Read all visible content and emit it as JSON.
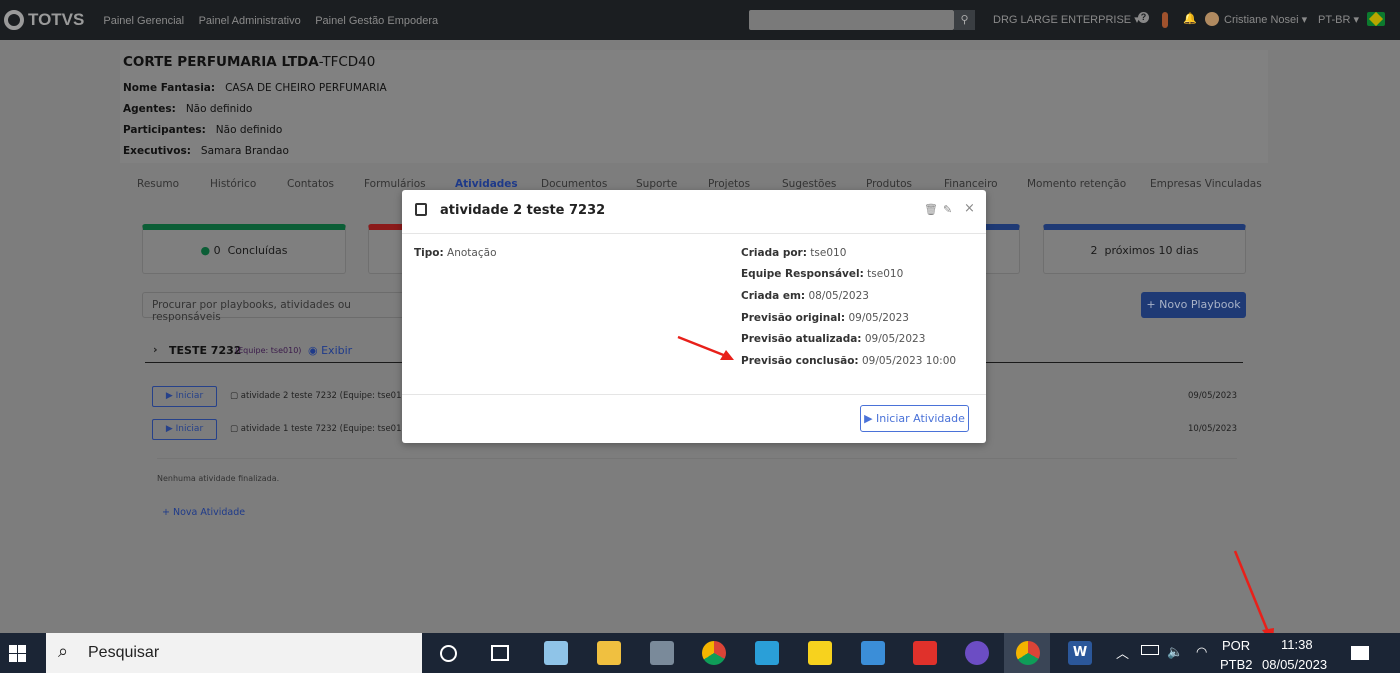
{
  "topbar": {
    "logo": "TOTVS",
    "nav": [
      "Painel Gerencial",
      "Painel Administrativo",
      "Painel Gestão Empodera"
    ],
    "search_placeholder": "",
    "company": "DRG LARGE ENTERPRISE",
    "user": "Cristiane Nosei",
    "language": "PT-BR"
  },
  "account": {
    "name": "CORTE PERFUMARIA LTDA",
    "code": "-TFCD40",
    "fields": [
      {
        "label": "Nome Fantasia:",
        "value": "CASA DE CHEIRO PERFUMARIA"
      },
      {
        "label": "Agentes:",
        "value": "Não definido"
      },
      {
        "label": "Participantes:",
        "value": "Não definido"
      },
      {
        "label": "Executivos:",
        "value": "Samara Brandao"
      }
    ]
  },
  "tabs": [
    "Resumo",
    "Histórico",
    "Contatos",
    "Formulários",
    "Atividades",
    "Documentos",
    "Suporte",
    "Projetos",
    "Sugestões",
    "Produtos",
    "Financeiro",
    "Momento retenção",
    "Empresas Vinculadas"
  ],
  "active_tab": "Atividades",
  "cards": [
    {
      "count": "0",
      "label": "Concluídas",
      "color": "#0b5e36"
    },
    {
      "color": "#8b1a1a"
    },
    {
      "color": "#1f3a75"
    },
    {
      "count": "2",
      "label": "próximos 10 dias",
      "color": "#1f3a75"
    }
  ],
  "playbook_search_placeholder": "Procurar por playbooks, atividades ou responsáveis",
  "new_playbook": "Novo Playbook",
  "group": {
    "name": "TESTE 7232",
    "team": "(Equipe: tse010)",
    "show": "Exibir"
  },
  "activities": [
    {
      "button": "Iniciar",
      "name": "atividade 2 teste 7232 (Equipe: tse010)",
      "date": "09/05/2023"
    },
    {
      "button": "Iniciar",
      "name": "atividade 1 teste 7232 (Equipe: tse010)",
      "date": "10/05/2023"
    }
  ],
  "no_finished": "Nenhuma atividade finalizada.",
  "new_activity": "Nova Atividade",
  "modal": {
    "title": "atividade 2 teste 7232",
    "tipo_label": "Tipo:",
    "tipo_value": "Anotação",
    "details": [
      {
        "label": "Criada por:",
        "value": "tse010"
      },
      {
        "label": "Equipe Responsável:",
        "value": "tse010"
      },
      {
        "label": "Criada em:",
        "value": "08/05/2023"
      },
      {
        "label": "Previsão original:",
        "value": "09/05/2023"
      },
      {
        "label": "Previsão atualizada:",
        "value": "09/05/2023"
      },
      {
        "label": "Previsão conclusão:",
        "value": "09/05/2023 10:00"
      }
    ],
    "start_button": "Iniciar Atividade"
  },
  "taskbar": {
    "search": "Pesquisar",
    "lang1": "POR",
    "lang2": "PTB2",
    "time": "11:38",
    "date": "08/05/2023"
  },
  "annotation_color": "#e8201a"
}
